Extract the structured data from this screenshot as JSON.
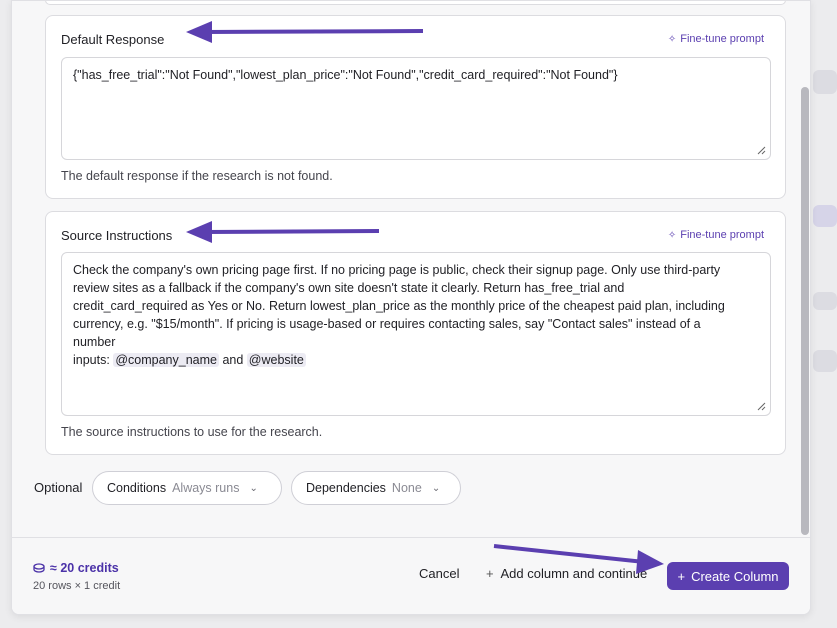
{
  "default_response": {
    "title": "Default Response",
    "fine_tune_label": "Fine-tune prompt",
    "value": "{\"has_free_trial\":\"Not Found\",\"lowest_plan_price\":\"Not Found\",\"credit_card_required\":\"Not Found\"}",
    "helper": "The default response if the research is not found."
  },
  "source_instructions": {
    "title": "Source Instructions",
    "fine_tune_label": "Fine-tune prompt",
    "value_lines": [
      "Check the company's own pricing page first. If no pricing page is public, check their signup page. Only use third-party",
      "review sites as a fallback if the company's own site doesn't state it clearly. Return has_free_trial and",
      "credit_card_required as Yes or No. Return lowest_plan_price as the monthly price of the cheapest paid plan, including",
      "currency, e.g. \"$15/month\". If pricing is usage-based or requires contacting sales, say \"Contact sales\" instead of a",
      "number"
    ],
    "inputs_prefix": "inputs:",
    "input_var_1": "@company_name",
    "inputs_and": "and",
    "input_var_2": "@website",
    "helper": "The source instructions to use for the research."
  },
  "optional": {
    "label": "Optional",
    "conditions_label": "Conditions",
    "conditions_value": "Always runs",
    "dependencies_label": "Dependencies",
    "dependencies_value": "None"
  },
  "footer": {
    "credits": "≈ 20 credits",
    "credits_sub": "20 rows × 1 credit",
    "cancel": "Cancel",
    "add_continue": "Add column and continue",
    "create": "Create Column"
  },
  "colors": {
    "accent": "#5b3fb0",
    "arrow": "#5b3fb0"
  }
}
